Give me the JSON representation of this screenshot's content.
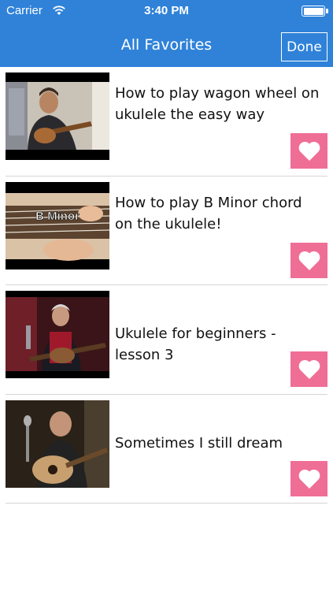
{
  "status_bar": {
    "carrier": "Carrier",
    "time": "3:40 PM"
  },
  "nav": {
    "title": "All Favorites",
    "done_label": "Done"
  },
  "colors": {
    "nav_bar": "#2f82d8",
    "heart_button": "#ef6e95",
    "separator": "#d6d6d6"
  },
  "favorites": [
    {
      "title": "How to play wagon wheel on ukulele the easy way",
      "thumbnail_icon": "video-thumbnail",
      "action_icon": "heart-icon"
    },
    {
      "title": "How to play B Minor chord on the ukulele!",
      "thumbnail_icon": "video-thumbnail",
      "thumbnail_text": "B Minor",
      "action_icon": "heart-icon"
    },
    {
      "title": "Ukulele for beginners - lesson 3",
      "thumbnail_icon": "video-thumbnail",
      "action_icon": "heart-icon"
    },
    {
      "title": "Sometimes I still dream",
      "thumbnail_icon": "video-thumbnail",
      "action_icon": "heart-icon"
    }
  ]
}
